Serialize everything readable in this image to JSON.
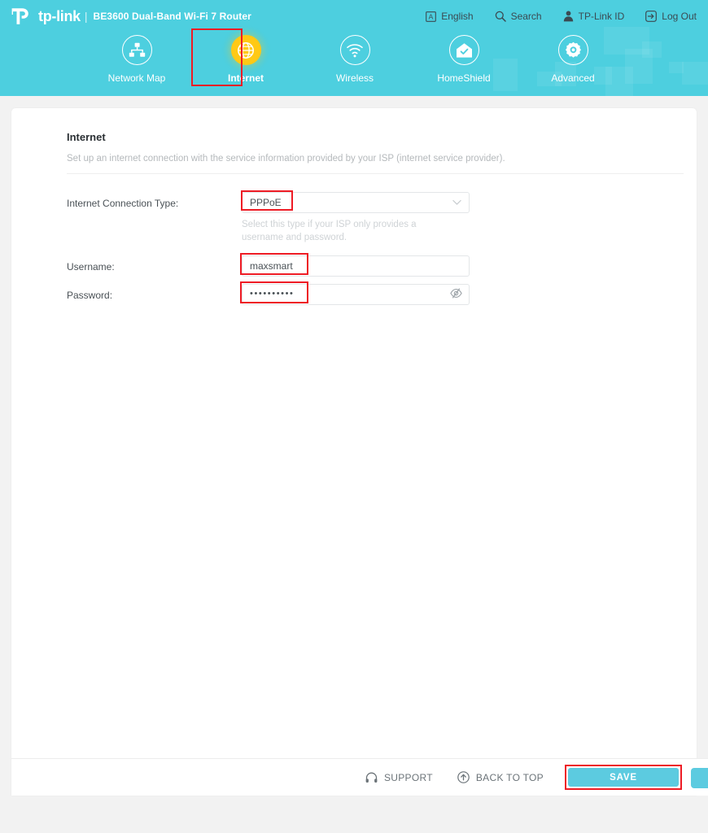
{
  "brand": {
    "logo_text": "tp-link",
    "divider": "|",
    "model": "BE3600 Dual-Band Wi-Fi 7 Router"
  },
  "topbar": {
    "items": [
      {
        "label": "English",
        "icon": "language-icon"
      },
      {
        "label": "Search",
        "icon": "search-icon"
      },
      {
        "label": "TP-Link ID",
        "icon": "user-account-icon"
      },
      {
        "label": "Log Out",
        "icon": "logout-icon"
      }
    ]
  },
  "nav": {
    "tabs": [
      {
        "label": "Network Map",
        "icon": "network-map-icon",
        "active": false
      },
      {
        "label": "Internet",
        "icon": "globe-icon",
        "active": true
      },
      {
        "label": "Wireless",
        "icon": "wifi-icon",
        "active": false
      },
      {
        "label": "HomeShield",
        "icon": "home-shield-icon",
        "active": false
      },
      {
        "label": "Advanced",
        "icon": "gear-icon",
        "active": false
      }
    ]
  },
  "main": {
    "title": "Internet",
    "description": "Set up an internet connection with the service information provided by your ISP (internet service provider).",
    "form": {
      "connection_type": {
        "label": "Internet Connection Type:",
        "value": "PPPoE",
        "helper": "Select this type if your ISP only provides a username and password."
      },
      "username": {
        "label": "Username:",
        "value": "maxsmart"
      },
      "password": {
        "label": "Password:",
        "value": "••••••••••"
      }
    }
  },
  "footer": {
    "support_label": "SUPPORT",
    "back_to_top_label": "BACK TO TOP",
    "save_label": "SAVE"
  },
  "colors": {
    "header_cyan": "#4dcfdf",
    "active_tab_yellow": "#ffc915",
    "save_button": "#5ccbe0",
    "highlight_red": "#ee1c25",
    "page_background": "#f2f2f2"
  }
}
